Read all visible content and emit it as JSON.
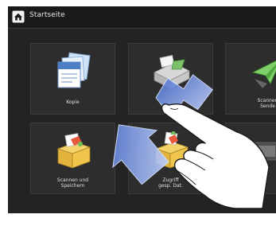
{
  "header": {
    "title": "Startseite"
  },
  "tiles": [
    {
      "label": "Kopie",
      "icon": "copy-icon"
    },
    {
      "label": "",
      "icon": "fax-icon"
    },
    {
      "label": "Scannen\nSende",
      "icon": "scan-send-icon"
    },
    {
      "label": "Scannen und\nSpeichern",
      "icon": "scan-store-icon"
    },
    {
      "label": "Zugriff\ngesp. Dat.",
      "icon": "stored-files-icon"
    },
    {
      "label": "",
      "icon": "app-icon"
    }
  ],
  "gesture": {
    "type": "swipe",
    "hand_icon": "hand-pointer-icon",
    "arrow_icon": "swipe-arrow-icon"
  },
  "colors": {
    "panel_bg": "#232323",
    "tile_bg": "#2d2d2d",
    "text": "#e0e0e0",
    "arrow": "#6f8fd8"
  }
}
